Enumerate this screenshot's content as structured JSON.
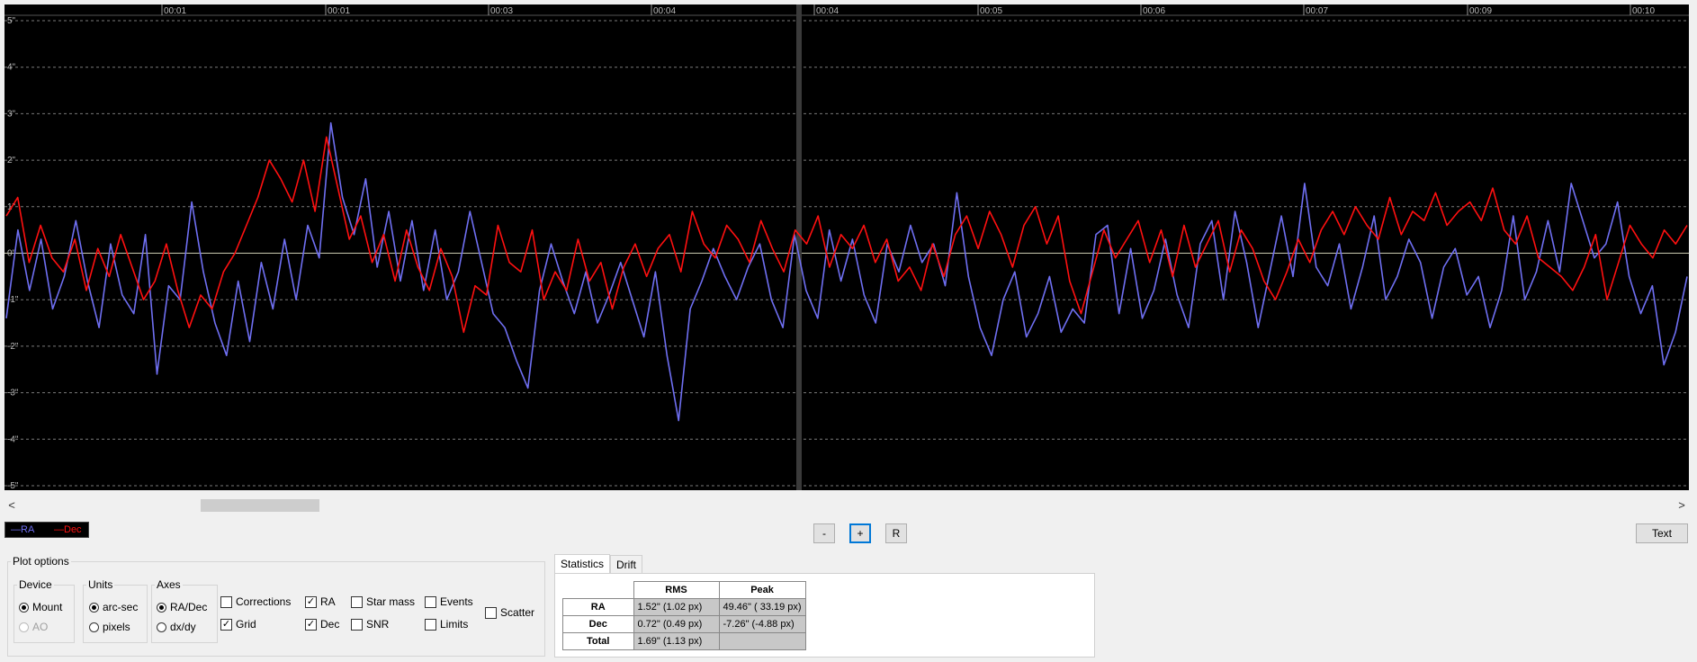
{
  "plot": {
    "time_labels": [
      "00:01",
      "00:01",
      "00:03",
      "00:04",
      "00:04",
      "00:05",
      "00:06",
      "00:07",
      "00:09",
      "00:10"
    ],
    "y_labels": [
      "5\"",
      "4\"",
      "3\"",
      "2\"",
      "1\"",
      "0\"",
      "-1\"",
      "-2\"",
      "-3\"",
      "-4\"",
      "-5\""
    ],
    "colors": {
      "ra": "#6f6ff2",
      "dec": "#ff1010",
      "grid": "#7a7a7a",
      "zero_line": "#c8c8b0",
      "background": "#000000"
    }
  },
  "scroll": {
    "left_arrow": "<",
    "right_arrow": ">"
  },
  "legend": {
    "ra": "—RA",
    "dec": "—Dec"
  },
  "buttons": {
    "minus": "-",
    "plus": "+",
    "reset": "R",
    "text": "Text"
  },
  "plot_options": {
    "title": "Plot options",
    "device": {
      "label": "Device",
      "mount": "Mount",
      "ao": "AO",
      "selected": "Mount"
    },
    "units": {
      "label": "Units",
      "arcsec": "arc-sec",
      "pixels": "pixels",
      "selected": "arc-sec"
    },
    "axes": {
      "label": "Axes",
      "radec": "RA/Dec",
      "dxdy": "dx/dy",
      "selected": "RA/Dec"
    },
    "checks": {
      "corrections": {
        "label": "Corrections",
        "checked": false
      },
      "grid": {
        "label": "Grid",
        "checked": true
      },
      "ra": {
        "label": "RA",
        "checked": true
      },
      "dec": {
        "label": "Dec",
        "checked": true
      },
      "star_mass": {
        "label": "Star mass",
        "checked": false
      },
      "snr": {
        "label": "SNR",
        "checked": false
      },
      "events": {
        "label": "Events",
        "checked": false
      },
      "limits": {
        "label": "Limits",
        "checked": false
      },
      "scatter": {
        "label": "Scatter",
        "checked": false
      }
    }
  },
  "stats_tabs": {
    "statistics": "Statistics",
    "drift": "Drift"
  },
  "stats": {
    "headers": [
      "RMS",
      "Peak"
    ],
    "rows": [
      {
        "label": "RA",
        "rms": "1.52\" (1.02 px)",
        "peak": "49.46\" ( 33.19 px)"
      },
      {
        "label": "Dec",
        "rms": "0.72\" (0.49 px)",
        "peak": "-7.26\" (-4.88 px)"
      },
      {
        "label": "Total",
        "rms": "1.69\" (1.13 px)",
        "peak": ""
      }
    ]
  },
  "chart_data": {
    "type": "line",
    "ylim": [
      -5,
      5
    ],
    "x_ticks": [
      "00:01",
      "00:01",
      "00:03",
      "00:04",
      "00:04",
      "00:05",
      "00:06",
      "00:07",
      "00:09",
      "00:10"
    ],
    "series": [
      {
        "name": "RA",
        "color": "#6f6ff2",
        "values": [
          -1.4,
          0.5,
          -0.8,
          0.3,
          -1.2,
          -0.5,
          0.7,
          -0.6,
          -1.6,
          0.2,
          -0.9,
          -1.3,
          0.4,
          -2.6,
          -0.7,
          -1.0,
          1.1,
          -0.4,
          -1.5,
          -2.2,
          -0.6,
          -1.9,
          -0.2,
          -1.2,
          0.3,
          -1.0,
          0.6,
          -0.1,
          2.8,
          1.2,
          0.4,
          1.6,
          -0.3,
          0.9,
          -0.6,
          0.7,
          -0.8,
          0.5,
          -1.0,
          -0.4,
          0.9,
          -0.2,
          -1.3,
          -1.6,
          -2.3,
          -2.9,
          -0.8,
          0.2,
          -0.6,
          -1.3,
          -0.4,
          -1.5,
          -0.9,
          -0.2,
          -1.0,
          -1.8,
          -0.4,
          -2.2,
          -3.6,
          -1.2,
          -0.6,
          0.1,
          -0.5,
          -1.0,
          -0.3,
          0.2,
          -1.0,
          -1.6,
          0.4,
          -0.8,
          -1.4,
          0.5,
          -0.6,
          0.3,
          -0.9,
          -1.5,
          0.2,
          -0.4,
          0.6,
          -0.2,
          0.2,
          -0.7,
          1.3,
          -0.5,
          -1.6,
          -2.2,
          -1.0,
          -0.4,
          -1.8,
          -1.3,
          -0.5,
          -1.7,
          -1.2,
          -1.5,
          0.4,
          0.6,
          -1.3,
          0.1,
          -1.4,
          -0.8,
          0.3,
          -0.9,
          -1.6,
          0.2,
          0.7,
          -1.0,
          0.9,
          -0.2,
          -1.6,
          -0.4,
          0.8,
          -0.5,
          1.5,
          -0.3,
          -0.7,
          0.2,
          -1.2,
          -0.3,
          0.8,
          -1.0,
          -0.5,
          0.3,
          -0.2,
          -1.4,
          -0.3,
          0.1,
          -0.9,
          -0.5,
          -1.6,
          -0.8,
          0.8,
          -1.0,
          -0.4,
          0.7,
          -0.4,
          1.5,
          0.7,
          -0.1,
          0.2,
          1.1,
          -0.5,
          -1.3,
          -0.7,
          -2.4,
          -1.7,
          -0.5
        ]
      },
      {
        "name": "Dec",
        "color": "#ff1010",
        "values": [
          0.8,
          1.2,
          -0.2,
          0.6,
          -0.1,
          -0.4,
          0.3,
          -0.8,
          0.1,
          -0.5,
          0.4,
          -0.3,
          -1.0,
          -0.6,
          0.2,
          -0.8,
          -1.6,
          -0.9,
          -1.2,
          -0.4,
          0.0,
          0.6,
          1.2,
          2.0,
          1.6,
          1.1,
          2.0,
          0.9,
          2.5,
          1.4,
          0.3,
          0.8,
          -0.2,
          0.4,
          -0.6,
          0.5,
          -0.3,
          -0.8,
          0.1,
          -0.5,
          -1.7,
          -0.7,
          -0.9,
          0.6,
          -0.2,
          -0.4,
          0.5,
          -1.0,
          -0.4,
          -0.8,
          0.3,
          -0.6,
          -0.2,
          -1.2,
          -0.3,
          0.2,
          -0.5,
          0.1,
          0.4,
          -0.4,
          0.9,
          0.2,
          -0.1,
          0.6,
          0.3,
          -0.2,
          0.7,
          0.1,
          -0.4,
          0.5,
          0.2,
          0.8,
          -0.3,
          0.4,
          0.1,
          0.6,
          -0.2,
          0.3,
          -0.6,
          -0.3,
          -0.8,
          0.2,
          -0.5,
          0.4,
          0.8,
          0.1,
          0.9,
          0.4,
          -0.3,
          0.6,
          1.0,
          0.2,
          0.8,
          -0.6,
          -1.3,
          -0.4,
          0.5,
          -0.1,
          0.3,
          0.7,
          -0.2,
          0.5,
          -0.5,
          0.6,
          -0.3,
          0.2,
          0.7,
          -0.4,
          0.5,
          0.1,
          -0.6,
          -1.0,
          -0.4,
          0.3,
          -0.2,
          0.5,
          0.9,
          0.4,
          1.0,
          0.6,
          0.3,
          1.2,
          0.4,
          0.9,
          0.7,
          1.3,
          0.6,
          0.9,
          1.1,
          0.7,
          1.4,
          0.5,
          0.2,
          0.8,
          -0.1,
          -0.3,
          -0.5,
          -0.8,
          -0.3,
          0.4,
          -1.0,
          -0.2,
          0.6,
          0.2,
          -0.1,
          0.5,
          0.2,
          0.6
        ]
      }
    ]
  }
}
